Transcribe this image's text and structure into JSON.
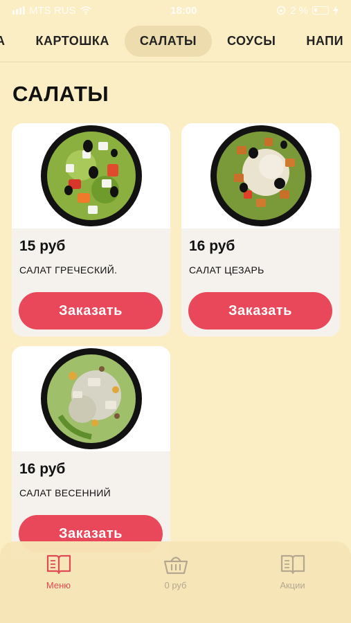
{
  "status_bar": {
    "carrier": "MTS RUS",
    "time": "18:00",
    "battery": "2 %"
  },
  "tabs": [
    {
      "label": "А"
    },
    {
      "label": "КАРТОШКА"
    },
    {
      "label": "САЛАТЫ",
      "active": true
    },
    {
      "label": "СОУСЫ"
    },
    {
      "label": "НАПИ"
    }
  ],
  "section": {
    "title": "САЛАТЫ"
  },
  "products": [
    {
      "price": "15 руб",
      "name": "САЛАТ ГРЕЧЕСКИЙ.",
      "button": "Заказать",
      "image": "greek-salad-image"
    },
    {
      "price": "16 руб",
      "name": "САЛАТ ЦЕЗАРЬ",
      "button": "Заказать",
      "image": "caesar-salad-image"
    },
    {
      "price": "16 руб",
      "name": "САЛАТ ВЕСЕННИЙ",
      "button": "Заказать",
      "image": "spring-salad-image"
    }
  ],
  "bottom_nav": [
    {
      "label": "Меню",
      "icon": "menu-book-icon",
      "active": true
    },
    {
      "label": "0 руб",
      "icon": "basket-icon"
    },
    {
      "label": "Акции",
      "icon": "promo-book-icon"
    }
  ],
  "colors": {
    "background": "#fbeec5",
    "accent": "#e8485a",
    "tab_active": "#ecdcae"
  }
}
